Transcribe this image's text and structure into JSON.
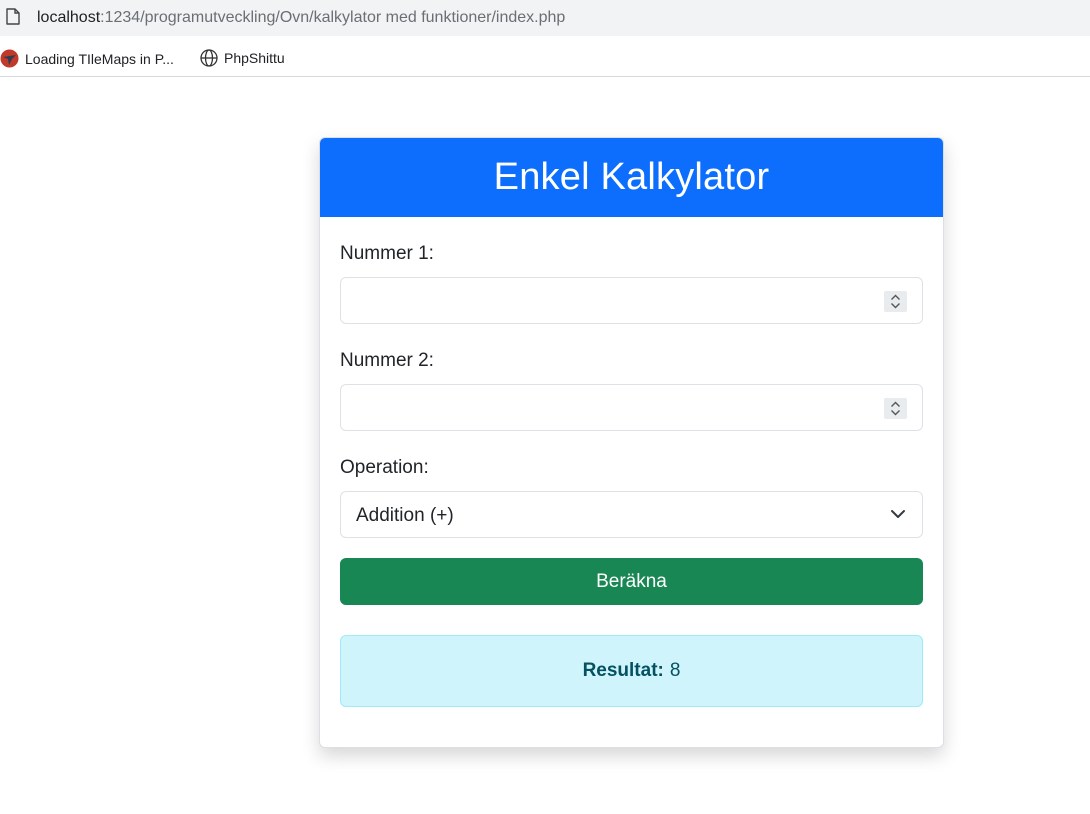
{
  "browser": {
    "url_host": "localhost",
    "url_path": ":1234/programutveckling/Ovn/kalkylator med funktioner/index.php",
    "bookmarks": [
      {
        "label": "Loading TIleMaps in P..."
      },
      {
        "label": "PhpShittu"
      }
    ]
  },
  "calculator": {
    "title": "Enkel Kalkylator",
    "number1_label": "Nummer 1:",
    "number1_value": "",
    "number2_label": "Nummer 2:",
    "number2_value": "",
    "operation_label": "Operation:",
    "operation_selected": "Addition (+)",
    "submit_label": "Beräkna",
    "result_label": "Resultat:",
    "result_value": "8"
  },
  "colors": {
    "header": "#0d6efd",
    "button": "#198754",
    "alert_bg": "#cff4fc",
    "alert_text": "#055160"
  }
}
